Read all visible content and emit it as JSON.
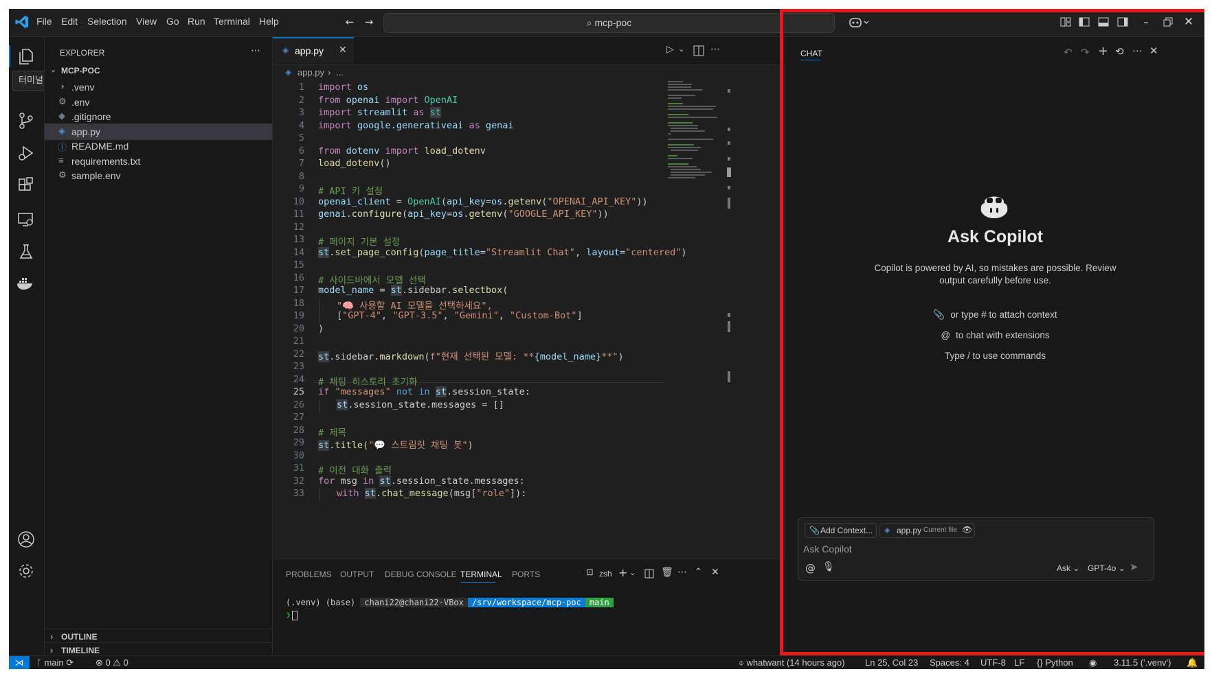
{
  "menu": [
    "File",
    "Edit",
    "Selection",
    "View",
    "Go",
    "Run",
    "Terminal",
    "Help"
  ],
  "search": {
    "text": "mcp-poc"
  },
  "activity": {
    "tooltip": "터미널"
  },
  "explorer": {
    "title": "EXPLORER",
    "folder": "MCP-POC",
    "files": [
      ".venv",
      ".env",
      ".gitignore",
      "app.py",
      "README.md",
      "requirements.txt",
      "sample.env"
    ],
    "outline": "OUTLINE",
    "timeline": "TIMELINE"
  },
  "editor": {
    "tab": "app.py",
    "breadcrumb": "app.py",
    "breadcrumb_more": "...",
    "line_numbers": [
      "1",
      "2",
      "3",
      "4",
      "5",
      "6",
      "7",
      "8",
      "9",
      "10",
      "11",
      "12",
      "13",
      "14",
      "15",
      "16",
      "17",
      "18",
      "19",
      "20",
      "21",
      "22",
      "23",
      "24",
      "25",
      "26",
      "27",
      "28",
      "29",
      "30",
      "31",
      "32",
      "33"
    ],
    "code": {
      "l1a": "import",
      "l1b": "os",
      "l2a": "from",
      "l2b": "openai",
      "l2c": "import",
      "l2d": "OpenAI",
      "l3a": "import",
      "l3b": "streamlit",
      "l3c": "as",
      "l3d": "st",
      "l4a": "import",
      "l4b": "google.generativeai",
      "l4c": "as",
      "l4d": "genai",
      "l6a": "from",
      "l6b": "dotenv",
      "l6c": "import",
      "l6d": "load_dotenv",
      "l7a": "load_dotenv",
      "l7b": "()",
      "l9": "# API 키 설정",
      "l10a": "openai_client",
      "l10b": " = ",
      "l10c": "OpenAI",
      "l10d": "(",
      "l10e": "api_key",
      "l10f": "=",
      "l10g": "os",
      "l10h": ".",
      "l10i": "getenv",
      "l10j": "(",
      "l10k": "\"OPENAI_API_KEY\"",
      "l10l": "))",
      "l11a": "genai",
      "l11b": ".",
      "l11c": "configure",
      "l11d": "(",
      "l11e": "api_key",
      "l11f": "=",
      "l11g": "os",
      "l11h": ".",
      "l11i": "getenv",
      "l11j": "(",
      "l11k": "\"GOOGLE_API_KEY\"",
      "l11l": "))",
      "l13": "# 페이지 기본 설정",
      "l14a": "st",
      "l14b": ".",
      "l14c": "set_page_config",
      "l14d": "(",
      "l14e": "page_title",
      "l14f": "=",
      "l14g": "\"Streamlit Chat\"",
      "l14h": ", ",
      "l14i": "layout",
      "l14j": "=",
      "l14k": "\"centered\"",
      "l14l": ")",
      "l16": "# 사이드바에서 모델 선택",
      "l17a": "model_name",
      "l17b": " = ",
      "l17c": "st",
      "l17d": ".sidebar.",
      "l17e": "selectbox",
      "l17f": "(",
      "l18": "\"🧠 사용할 AI 모델을 선택하세요\",",
      "l19a": "[",
      "l19b": "\"GPT-4\"",
      "l19c": ", ",
      "l19d": "\"GPT-3.5\"",
      "l19e": ", ",
      "l19f": "\"Gemini\"",
      "l19g": ", ",
      "l19h": "\"Custom-Bot\"",
      "l19i": "]",
      "l20": ")",
      "l22a": "st",
      "l22b": ".sidebar.",
      "l22c": "markdown",
      "l22d": "(",
      "l22e": "f\"현재 선택된 모델: **",
      "l22f": "{model_name}",
      "l22g": "**\"",
      "l22h": ")",
      "l24": "# 채팅 히스토리 초기화",
      "l25a": "if",
      "l25b": " \"messages\" ",
      "l25c": "not in",
      "l25d": " ",
      "l25e": "st",
      "l25f": ".session_state:",
      "l26a": "st",
      "l26b": ".session_state.messages = []",
      "l28": "# 제목",
      "l29a": "st",
      "l29b": ".",
      "l29c": "title",
      "l29d": "(",
      "l29e": "\"💬 스트림릿 채팅 봇\"",
      "l29f": ")",
      "l31": "# 이전 대화 출력",
      "l32a": "for",
      "l32b": " msg ",
      "l32c": "in",
      "l32d": " ",
      "l32e": "st",
      "l32f": ".session_state.messages:",
      "l33a": "with",
      "l33b": " ",
      "l33c": "st",
      "l33d": ".",
      "l33e": "chat_message",
      "l33f": "(msg[",
      "l33g": "\"role\"",
      "l33h": "]):"
    }
  },
  "panel": {
    "tabs": [
      "PROBLEMS",
      "OUTPUT",
      "DEBUG CONSOLE",
      "TERMINAL",
      "PORTS"
    ],
    "shell": "zsh",
    "prompt_env": "(.venv) (base)",
    "prompt_user": "chani22@chani22-VBox",
    "prompt_path": "/srv/workspace/mcp-poc",
    "prompt_branch": "main",
    "prompt_arrow": "❯"
  },
  "chat": {
    "title": "CHAT",
    "heading": "Ask Copilot",
    "desc1": "Copilot is powered by AI, so mistakes are possible. Review",
    "desc2": "output carefully before use.",
    "hint1": "or type # to attach context",
    "hint2": "to chat with extensions",
    "hint3": "Type / to use commands",
    "add_context": "Add Context...",
    "file_chip": "app.py",
    "file_chip_note": "Current file",
    "placeholder": "Ask Copilot",
    "mode": "Ask",
    "model": "GPT-4o"
  },
  "status": {
    "branch": "main",
    "errors": "0",
    "warnings": "0",
    "blame": "whatwant (14 hours ago)",
    "position": "Ln 25, Col 23",
    "spaces": "Spaces: 4",
    "encoding": "UTF-8",
    "eol": "LF",
    "language": "Python",
    "interpreter": "3.11.5 ('.venv')"
  },
  "colors": {
    "accent": "#0078d4",
    "highlight": "#e51b1b",
    "terminal_path": "#0a7bd4",
    "terminal_branch": "#2ea043"
  }
}
